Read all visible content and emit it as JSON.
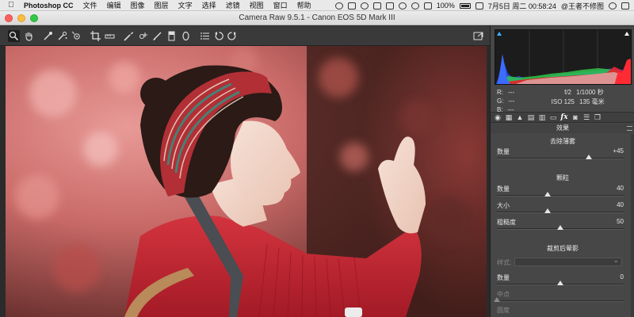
{
  "menubar": {
    "app_name": "Photoshop CC",
    "items": [
      "文件",
      "编辑",
      "图像",
      "图层",
      "文字",
      "选择",
      "滤镜",
      "视图",
      "窗口",
      "帮助"
    ],
    "battery": "100%",
    "datetime": "7月5日 周二  00:58:24",
    "user": "@王者不修图",
    "icons": [
      "apple-icon",
      "record-icon",
      "activity-icon",
      "creative-cloud-icon",
      "cast-icon",
      "bluetooth-icon",
      "timer-icon",
      "wifi-icon",
      "volume-icon",
      "battery-icon",
      "input-method-icon",
      "search-icon",
      "list-icon"
    ]
  },
  "window": {
    "title": "Camera Raw 9.5.1  -  Canon EOS 5D Mark III"
  },
  "toolbar": {
    "tools": [
      "zoom-tool-icon",
      "hand-tool-icon",
      "white-balance-tool-icon",
      "color-sampler-icon",
      "targeted-adjustment-icon",
      "crop-tool-icon",
      "straighten-tool-icon",
      "spot-removal-icon",
      "red-eye-icon",
      "adjustment-brush-icon",
      "graduated-filter-icon",
      "radial-filter-icon",
      "preferences-icon",
      "rotate-ccw-icon",
      "rotate-cw-icon",
      "fullscreen-icon"
    ]
  },
  "readout": {
    "r_label": "R:",
    "g_label": "G:",
    "b_label": "B:",
    "r_value": "---",
    "g_value": "---",
    "b_value": "---",
    "aperture": "f/2",
    "shutter": "1/1000 秒",
    "iso": "ISO 125",
    "focal": "135 毫米"
  },
  "panel": {
    "section_title": "效果",
    "tabs": [
      "basic-tab-icon",
      "tone-curve-tab-icon",
      "detail-tab-icon",
      "hsl-tab-icon",
      "split-toning-tab-icon",
      "lens-tab-icon",
      "fx-tab-icon",
      "camera-calibration-tab-icon",
      "presets-tab-icon",
      "snapshots-tab-icon"
    ],
    "fx_label": "fx",
    "dehaze": {
      "title": "去除薄雾",
      "amount_label": "数量",
      "amount_value": "+45",
      "amount_level": 0.725
    },
    "grain": {
      "title": "颗粒",
      "amount_label": "数量",
      "amount_value": "40",
      "amount_level": 0.4,
      "size_label": "大小",
      "size_value": "40",
      "size_level": 0.4,
      "roughness_label": "粗糙度",
      "roughness_value": "50",
      "roughness_level": 0.5
    },
    "vignette": {
      "title": "裁剪后晕影",
      "style_label": "样式:",
      "amount_label": "数量",
      "amount_value": "0",
      "amount_level": 0.5,
      "midpoint_label": "中点",
      "midpoint_level": 0.0,
      "roundness_label": "圆度"
    }
  },
  "colors": {
    "accent": "#1c6ef2",
    "panel_bg": "#474747",
    "toolbar_bg": "#3a3a3a"
  }
}
